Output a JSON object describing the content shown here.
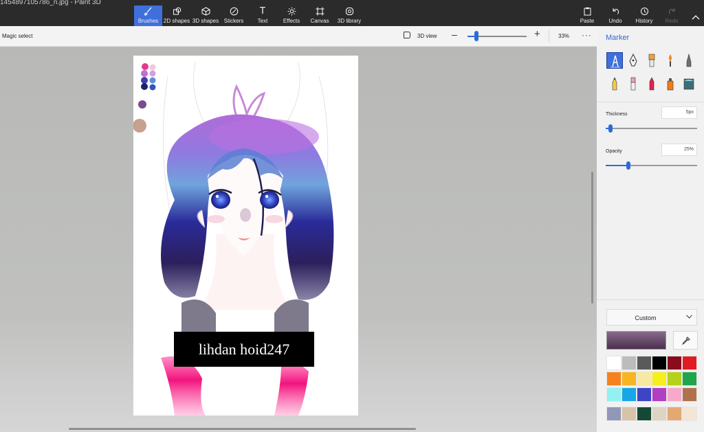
{
  "window": {
    "title": "1454897105786_n.jpg - Paint 3D"
  },
  "ribbon": {
    "tools": [
      {
        "label": "Brushes",
        "icon": "brush-icon",
        "active": true
      },
      {
        "label": "2D shapes",
        "icon": "shapes-2d-icon"
      },
      {
        "label": "3D shapes",
        "icon": "cube-icon"
      },
      {
        "label": "Stickers",
        "icon": "sticker-icon"
      },
      {
        "label": "Text",
        "icon": "text-icon"
      },
      {
        "label": "Effects",
        "icon": "sun-icon"
      },
      {
        "label": "Canvas",
        "icon": "canvas-icon"
      },
      {
        "label": "3D library",
        "icon": "library-icon"
      }
    ],
    "right_tools": [
      {
        "label": "Paste",
        "icon": "paste-icon"
      },
      {
        "label": "Undo",
        "icon": "undo-icon"
      },
      {
        "label": "History",
        "icon": "history-icon"
      },
      {
        "label": "Redo",
        "icon": "redo-icon",
        "disabled": true
      }
    ]
  },
  "toolbar": {
    "magic_select": "Magic select",
    "view_3d": "3D view",
    "zoom_percent": "33%",
    "zoom_level": 0.15
  },
  "canvas": {
    "watermark_text": "lihdan hoid247",
    "background": "#ffffff"
  },
  "panel": {
    "title": "Marker",
    "thickness_label": "Thickness",
    "thickness_value": "5px",
    "thickness_level": 0.05,
    "opacity_label": "Opacity",
    "opacity_value": "25%",
    "opacity_level": 0.25,
    "color_mode": "Custom",
    "current_color_gradient": [
      "#8a6a8c",
      "#4a2f4d"
    ],
    "palette": [
      "#ffffff",
      "#bcbcbc",
      "#5a5a5a",
      "#000000",
      "#8a0b1b",
      "#e01c22",
      "#f5821f",
      "#f7b521",
      "#f7e9a0",
      "#f7ef1a",
      "#b5d21b",
      "#1ea64b",
      "#93f1f1",
      "#18a7e6",
      "#3d45c6",
      "#b23fc1",
      "#f6a9c8",
      "#b0724c",
      "#9097b7",
      "#d7c3a7",
      "#144a35",
      "#ddd4c4",
      "#e6a872",
      "#f5e5d4"
    ]
  }
}
